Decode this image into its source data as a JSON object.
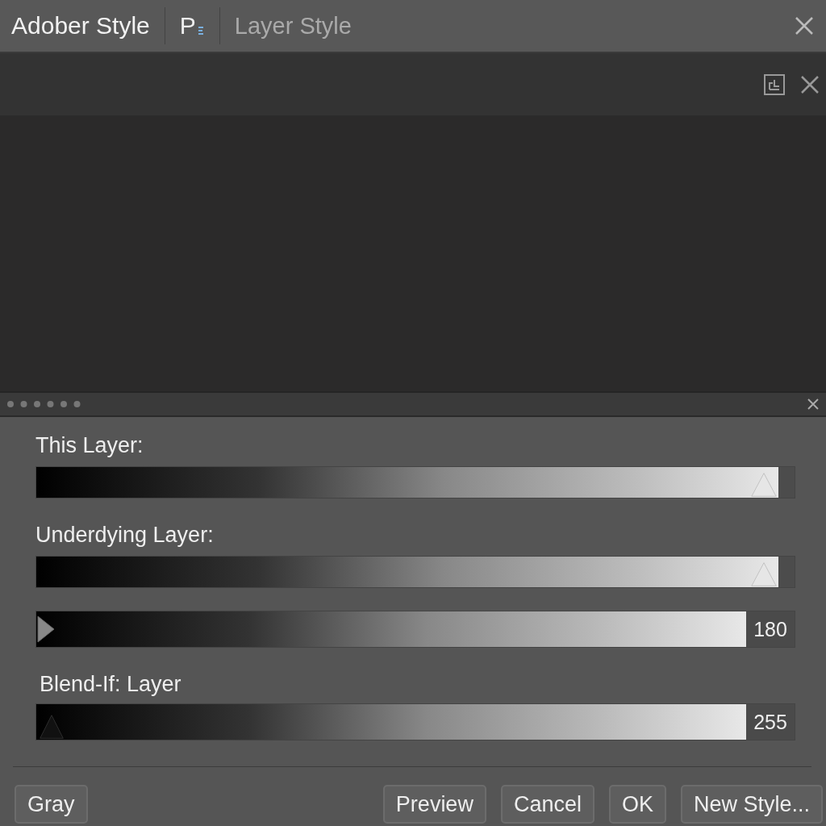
{
  "window": {
    "title": "Adober Style",
    "app_tab": "P",
    "dialog_title": "Layer Style"
  },
  "sliders": [
    {
      "label": "This Layer:",
      "kind": "pointer-up",
      "level": 0.98
    },
    {
      "label": "Underdying Layer:",
      "kind": "pointer-up",
      "level": 0.98
    },
    {
      "kind": "pointer-right",
      "level": 0,
      "reading": "180"
    },
    {
      "label": "Blend-If: Layer",
      "kind": "pointer-up-dark",
      "level": 0,
      "reading": "255"
    }
  ],
  "left_buttons": [
    "Gray"
  ],
  "right_buttons": [
    "Preview",
    "Cancel",
    "OK",
    "New Style..."
  ]
}
